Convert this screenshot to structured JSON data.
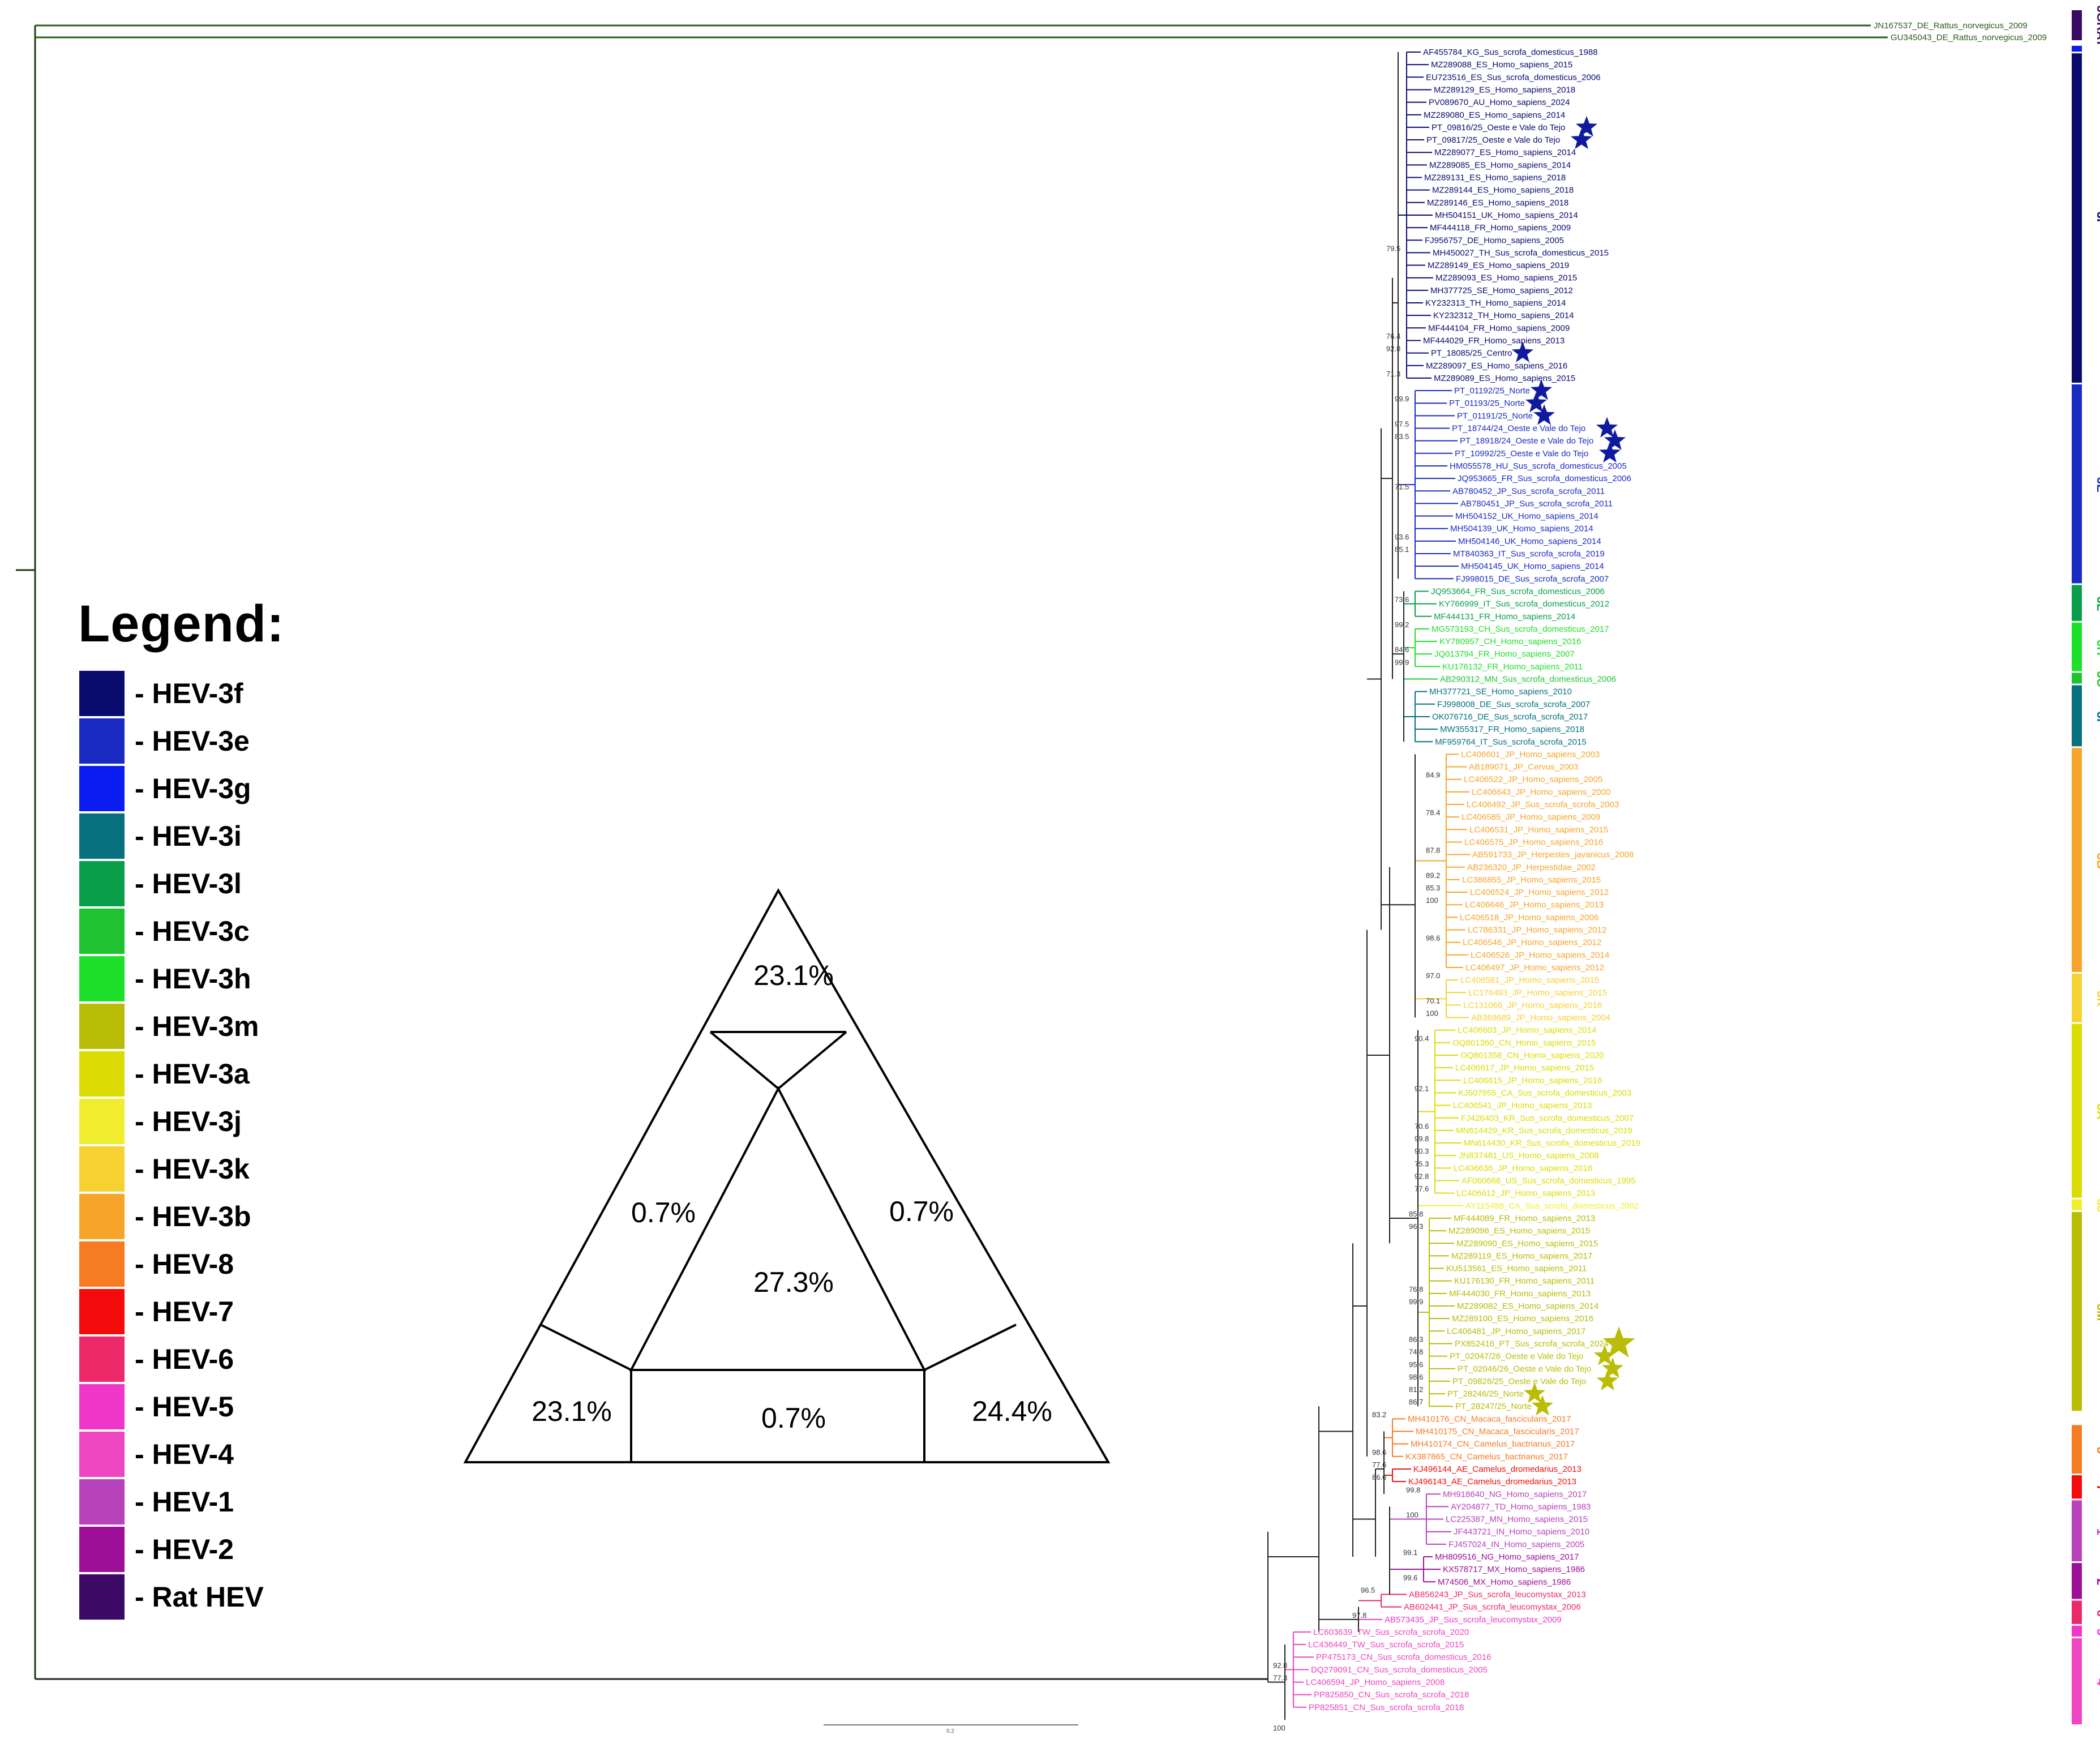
{
  "colors": {
    "3f": "#0b0b6e",
    "3e": "#1a2bc2",
    "3g": "#0b1cf3",
    "3i": "#06707f",
    "3l": "#099f4a",
    "3c": "#1fc331",
    "3h": "#1de02a",
    "3m": "#b9bd07",
    "3a": "#dcdc05",
    "3j": "#f1ee2f",
    "3k": "#f6d132",
    "3b": "#f6a52a",
    "hev8": "#f77b23",
    "hev7": "#f40b0b",
    "hev6": "#ec2a6a",
    "hev5": "#f037c9",
    "hev4": "#ee45c0",
    "hev1": "#b742bb",
    "hev2": "#9d0f96",
    "rat": "#3a0a64",
    "outgroup": "#2a5c1c",
    "star": "#0f1a9e",
    "star_m": "#b9bd07"
  },
  "legend": {
    "title": "Legend:",
    "items": [
      {
        "label": "- HEV-3f",
        "color": "#0b0b6e"
      },
      {
        "label": "- HEV-3e",
        "color": "#1a2bc2"
      },
      {
        "label": "- HEV-3g",
        "color": "#0b1cf3"
      },
      {
        "label": "- HEV-3i",
        "color": "#06707f"
      },
      {
        "label": "- HEV-3l",
        "color": "#099f4a"
      },
      {
        "label": "- HEV-3c",
        "color": "#1fc331"
      },
      {
        "label": "- HEV-3h",
        "color": "#1de02a"
      },
      {
        "label": "- HEV-3m",
        "color": "#b9bd07"
      },
      {
        "label": "- HEV-3a",
        "color": "#dcdc05"
      },
      {
        "label": "- HEV-3j",
        "color": "#f1ee2f"
      },
      {
        "label": "- HEV-3k",
        "color": "#f6d132"
      },
      {
        "label": "- HEV-3b",
        "color": "#f6a52a"
      },
      {
        "label": "- HEV-8",
        "color": "#f77b23"
      },
      {
        "label": "- HEV-7",
        "color": "#f40b0b"
      },
      {
        "label": "- HEV-6",
        "color": "#ec2a6a"
      },
      {
        "label": "- HEV-5",
        "color": "#f037c9"
      },
      {
        "label": "- HEV-4",
        "color": "#ee45c0"
      },
      {
        "label": "- HEV-1",
        "color": "#b742bb"
      },
      {
        "label": "- HEV-2",
        "color": "#9d0f96"
      },
      {
        "label": "- Rat HEV",
        "color": "#3a0a64"
      }
    ]
  },
  "triangle": {
    "top": "23.1%",
    "left_mid": "0.7%",
    "right_mid": "0.7%",
    "center": "27.3%",
    "bottom_left": "23.1%",
    "bottom_mid": "0.7%",
    "bottom_right": "24.4%"
  },
  "outgroup": [
    {
      "label": "JN167537_DE_Rattus_norvegicus_2009"
    },
    {
      "label": "GU345043_DE_Rattus_norvegicus_2009"
    }
  ],
  "taxa": [
    {
      "label": "AF455784_KG_Sus_scrofa_domesticus_1988",
      "c": "3f"
    },
    {
      "label": "MZ289088_ES_Homo_sapiens_2015",
      "c": "3f"
    },
    {
      "label": "EU723516_ES_Sus_scrofa_domesticus_2006",
      "c": "3f"
    },
    {
      "label": "MZ289129_ES_Homo_sapiens_2018",
      "c": "3f"
    },
    {
      "label": "PV089670_AU_Homo_sapiens_2024",
      "c": "3f"
    },
    {
      "label": "MZ289080_ES_Homo_sapiens_2014",
      "c": "3f"
    },
    {
      "label": "PT_09816/25_Oeste e Vale do Tejo",
      "c": "3f",
      "star": true
    },
    {
      "label": "PT_09817/25_Oeste e Vale do Tejo",
      "c": "3f",
      "star": true
    },
    {
      "label": "MZ289077_ES_Homo_sapiens_2014",
      "c": "3f"
    },
    {
      "label": "MZ289085_ES_Homo_sapiens_2014",
      "c": "3f"
    },
    {
      "label": "MZ289131_ES_Homo_sapiens_2018",
      "c": "3f"
    },
    {
      "label": "MZ289144_ES_Homo_sapiens_2018",
      "c": "3f"
    },
    {
      "label": "MZ289146_ES_Homo_sapiens_2018",
      "c": "3f"
    },
    {
      "label": "MH504151_UK_Homo_sapiens_2014",
      "c": "3f"
    },
    {
      "label": "MF444118_FR_Homo_sapiens_2009",
      "c": "3f"
    },
    {
      "label": "FJ956757_DE_Homo_sapiens_2005",
      "c": "3f"
    },
    {
      "label": "MH450027_TH_Sus_scrofa_domesticus_2015",
      "c": "3f"
    },
    {
      "label": "MZ289149_ES_Homo_sapiens_2019",
      "c": "3f"
    },
    {
      "label": "MZ289093_ES_Homo_sapiens_2015",
      "c": "3f"
    },
    {
      "label": "MH377725_SE_Homo_sapiens_2012",
      "c": "3f"
    },
    {
      "label": "KY232313_TH_Homo_sapiens_2014",
      "c": "3f"
    },
    {
      "label": "KY232312_TH_Homo_sapiens_2014",
      "c": "3f"
    },
    {
      "label": "MF444104_FR_Homo_sapiens_2009",
      "c": "3f"
    },
    {
      "label": "MF444029_FR_Homo_sapiens_2013",
      "c": "3f"
    },
    {
      "label": "PT_18085/25_Centro",
      "c": "3f",
      "star": true
    },
    {
      "label": "MZ289097_ES_Homo_sapiens_2016",
      "c": "3f"
    },
    {
      "label": "MZ289089_ES_Homo_sapiens_2015",
      "c": "3f"
    },
    {
      "label": "PT_01192/25_Norte",
      "c": "3e",
      "star": true
    },
    {
      "label": "PT_01193/25_Norte",
      "c": "3e",
      "star": true
    },
    {
      "label": "PT_01191/25_Norte",
      "c": "3e",
      "star": true
    },
    {
      "label": "PT_18744/24_Oeste e Vale do Tejo",
      "c": "3e",
      "star": true
    },
    {
      "label": "PT_18918/24_Oeste e Vale do Tejo",
      "c": "3e",
      "star": true
    },
    {
      "label": "PT_10992/25_Oeste e Vale do Tejo",
      "c": "3e",
      "star": true
    },
    {
      "label": "HM055578_HU_Sus_scrofa_domesticus_2005",
      "c": "3e"
    },
    {
      "label": "JQ953665_FR_Sus_scrofa_domesticus_2006",
      "c": "3e"
    },
    {
      "label": "AB780452_JP_Sus_scrofa_scrofa_2011",
      "c": "3e"
    },
    {
      "label": "AB780451_JP_Sus_scrofa_scrofa_2011",
      "c": "3e"
    },
    {
      "label": "MH504152_UK_Homo_sapiens_2014",
      "c": "3e"
    },
    {
      "label": "MH504139_UK_Homo_sapiens_2014",
      "c": "3e"
    },
    {
      "label": "MH504146_UK_Homo_sapiens_2014",
      "c": "3e"
    },
    {
      "label": "MT840363_IT_Sus_scrofa_scrofa_2019",
      "c": "3e"
    },
    {
      "label": "MH504145_UK_Homo_sapiens_2014",
      "c": "3e"
    },
    {
      "label": "FJ998015_DE_Sus_scrofa_scrofa_2007",
      "c": "3e"
    },
    {
      "label": "JQ953664_FR_Sus_scrofa_domesticus_2006",
      "c": "3l"
    },
    {
      "label": "KY766999_IT_Sus_scrofa_domesticus_2012",
      "c": "3l"
    },
    {
      "label": "MF444131_FR_Homo_sapiens_2014",
      "c": "3l"
    },
    {
      "label": "MG573193_CH_Sus_scrofa_domesticus_2017",
      "c": "3h"
    },
    {
      "label": "KY780957_CH_Homo_sapiens_2016",
      "c": "3h"
    },
    {
      "label": "JQ013794_FR_Homo_sapiens_2007",
      "c": "3h"
    },
    {
      "label": "KU176132_FR_Homo_sapiens_2011",
      "c": "3h"
    },
    {
      "label": "AB290312_MN_Sus_scrofa_domesticus_2006",
      "c": "3c"
    },
    {
      "label": "MH377721_SE_Homo_sapiens_2010",
      "c": "3i"
    },
    {
      "label": "FJ998008_DE_Sus_scrofa_scrofa_2007",
      "c": "3i"
    },
    {
      "label": "OK076716_DE_Sus_scrofa_scrofa_2017",
      "c": "3i"
    },
    {
      "label": "MW355317_FR_Homo_sapiens_2018",
      "c": "3i"
    },
    {
      "label": "MF959764_IT_Sus_scrofa_scrofa_2015",
      "c": "3i"
    },
    {
      "label": "LC406601_JP_Homo_sapiens_2003",
      "c": "3b"
    },
    {
      "label": "AB189071_JP_Cervus_2003",
      "c": "3b"
    },
    {
      "label": "LC406522_JP_Homo_sapiens_2005",
      "c": "3b"
    },
    {
      "label": "LC406643_JP_Homo_sapiens_2000",
      "c": "3b"
    },
    {
      "label": "LC406492_JP_Sus_scrofa_scrofa_2003",
      "c": "3b"
    },
    {
      "label": "LC406585_JP_Homo_sapiens_2009",
      "c": "3b"
    },
    {
      "label": "LC406531_JP_Homo_sapiens_2015",
      "c": "3b"
    },
    {
      "label": "LC406575_JP_Homo_sapiens_2016",
      "c": "3b"
    },
    {
      "label": "AB591733_JP_Herpestes_javanicus_2008",
      "c": "3b"
    },
    {
      "label": "AB236320_JP_Herpestidae_2002",
      "c": "3b"
    },
    {
      "label": "LC386855_JP_Homo_sapiens_2015",
      "c": "3b"
    },
    {
      "label": "LC406524_JP_Homo_sapiens_2012",
      "c": "3b"
    },
    {
      "label": "LC406646_JP_Homo_sapiens_2013",
      "c": "3b"
    },
    {
      "label": "LC406518_JP_Homo_sapiens_2006",
      "c": "3b"
    },
    {
      "label": "LC786331_JP_Homo_sapiens_2012",
      "c": "3b"
    },
    {
      "label": "LC406546_JP_Homo_sapiens_2012",
      "c": "3b"
    },
    {
      "label": "LC406526_JP_Homo_sapiens_2014",
      "c": "3b"
    },
    {
      "label": "LC406497_JP_Homo_sapiens_2012",
      "c": "3b"
    },
    {
      "label": "LC406581_JP_Homo_sapiens_2015",
      "c": "3k"
    },
    {
      "label": "LC176493_JP_Homo_sapiens_2015",
      "c": "3k"
    },
    {
      "label": "LC131066_JP_Homo_sapiens_2016",
      "c": "3k"
    },
    {
      "label": "AB369689_JP_Homo_sapiens_2004",
      "c": "3k"
    },
    {
      "label": "LC406603_JP_Homo_sapiens_2014",
      "c": "3a"
    },
    {
      "label": "OQ801360_CN_Homo_sapiens_2015",
      "c": "3a"
    },
    {
      "label": "OQ801358_CN_Homo_sapiens_2020",
      "c": "3a"
    },
    {
      "label": "LC406617_JP_Homo_sapiens_2015",
      "c": "3a"
    },
    {
      "label": "LC406615_JP_Homo_sapiens_2016",
      "c": "3a"
    },
    {
      "label": "KJ507955_CA_Sus_scrofa_domesticus_2003",
      "c": "3a"
    },
    {
      "label": "LC406541_JP_Homo_sapiens_2013",
      "c": "3a"
    },
    {
      "label": "FJ426403_KR_Sus_scrofa_domesticus_2007",
      "c": "3a"
    },
    {
      "label": "MN614429_KR_Sus_scrofa_domesticus_2019",
      "c": "3a"
    },
    {
      "label": "MN614430_KR_Sus_scrofa_domesticus_2019",
      "c": "3a"
    },
    {
      "label": "JN837481_US_Homo_sapiens_2008",
      "c": "3a"
    },
    {
      "label": "LC406636_JP_Homo_sapiens_2016",
      "c": "3a"
    },
    {
      "label": "AF060668_US_Sus_scrofa_domesticus_1995",
      "c": "3a"
    },
    {
      "label": "LC406612_JP_Homo_sapiens_2013",
      "c": "3a"
    },
    {
      "label": "AY115488_CA_Sus_scrofa_domesticus_2002",
      "c": "3j"
    },
    {
      "label": "MF444089_FR_Homo_sapiens_2013",
      "c": "3m"
    },
    {
      "label": "MZ289096_ES_Homo_sapiens_2015",
      "c": "3m"
    },
    {
      "label": "MZ289090_ES_Homo_sapiens_2015",
      "c": "3m"
    },
    {
      "label": "MZ289119_ES_Homo_sapiens_2017",
      "c": "3m"
    },
    {
      "label": "KU513561_ES_Homo_sapiens_2011",
      "c": "3m"
    },
    {
      "label": "KU176130_FR_Homo_sapiens_2011",
      "c": "3m"
    },
    {
      "label": "MF444030_FR_Homo_sapiens_2013",
      "c": "3m"
    },
    {
      "label": "MZ289082_ES_Homo_sapiens_2014",
      "c": "3m"
    },
    {
      "label": "MZ289100_ES_Homo_sapiens_2016",
      "c": "3m"
    },
    {
      "label": "LC406481_JP_Homo_sapiens_2017",
      "c": "3m"
    },
    {
      "label": "PX852416_PT_Sus_scrofa_scrofa_2024",
      "c": "3m",
      "star": true,
      "big": true
    },
    {
      "label": "PT_02047/26_Oeste e Vale do Tejo",
      "c": "3m",
      "star": true
    },
    {
      "label": "PT_02046/26_Oeste e Vale do Tejo",
      "c": "3m",
      "star": true
    },
    {
      "label": "PT_09826/25_Oeste e Vale do Tejo",
      "c": "3m",
      "star": true
    },
    {
      "label": "PT_28246/25_Norte",
      "c": "3m",
      "star": true
    },
    {
      "label": "PT_28247/25_Norte",
      "c": "3m",
      "star": true
    },
    {
      "label": "MH410176_CN_Macaca_fascicularis_2017",
      "c": "hev8"
    },
    {
      "label": "MH410175_CN_Macaca_fascicularis_2017",
      "c": "hev8"
    },
    {
      "label": "MH410174_CN_Camelus_bactrianus_2017",
      "c": "hev8"
    },
    {
      "label": "KX387865_CN_Camelus_bactrianus_2017",
      "c": "hev8"
    },
    {
      "label": "KJ496144_AE_Camelus_dromedarius_2013",
      "c": "hev7"
    },
    {
      "label": "KJ496143_AE_Camelus_dromedarius_2013",
      "c": "hev7"
    },
    {
      "label": "MH918640_NG_Homo_sapiens_2017",
      "c": "hev1"
    },
    {
      "label": "AY204877_TD_Homo_sapiens_1983",
      "c": "hev1"
    },
    {
      "label": "LC225387_MN_Homo_sapiens_2015",
      "c": "hev1"
    },
    {
      "label": "JF443721_IN_Homo_sapiens_2010",
      "c": "hev1"
    },
    {
      "label": "FJ457024_IN_Homo_sapiens_2005",
      "c": "hev1"
    },
    {
      "label": "MH809516_NG_Homo_sapiens_2017",
      "c": "hev2"
    },
    {
      "label": "KX578717_MX_Homo_sapiens_1986",
      "c": "hev2"
    },
    {
      "label": "M74506_MX_Homo_sapiens_1986",
      "c": "hev2"
    },
    {
      "label": "AB856243_JP_Sus_scrofa_leucomystax_2013",
      "c": "hev6"
    },
    {
      "label": "AB602441_JP_Sus_scrofa_leucomystax_2006",
      "c": "hev6"
    },
    {
      "label": "AB573435_JP_Sus_scrofa_leucomystax_2009",
      "c": "hev5"
    },
    {
      "label": "LC603639_TW_Sus_scrofa_scrofa_2020",
      "c": "hev4"
    },
    {
      "label": "LC436449_TW_Sus_scrofa_scrofa_2015",
      "c": "hev4"
    },
    {
      "label": "PP475173_CN_Sus_scrofa_domesticus_2016",
      "c": "hev4"
    },
    {
      "label": "DQ279091_CN_Sus_scrofa_domesticus_2005",
      "c": "hev4"
    },
    {
      "label": "LC406594_JP_Homo_sapiens_2008",
      "c": "hev4"
    },
    {
      "label": "PP825850_CN_Sus_scrofa_scrofa_2018",
      "c": "hev4"
    },
    {
      "label": "PP825851_CN_Sus_scrofa_scrofa_2018",
      "c": "hev4"
    }
  ],
  "bootstrap": [
    {
      "v": "79.5",
      "row": 16
    },
    {
      "v": "85.3",
      "row": 67
    },
    {
      "v": "96.3",
      "row": 94
    },
    {
      "v": "99.6",
      "row": 122
    },
    {
      "v": "77.3",
      "row": 130
    },
    {
      "v": "100",
      "row": 134
    },
    {
      "v": "76.9",
      "row": 138
    },
    {
      "v": "98.6",
      "row": 112
    },
    {
      "v": "86.6",
      "row": 114
    },
    {
      "v": "77.6",
      "row": 113
    },
    {
      "v": "99.8",
      "row": 115
    },
    {
      "v": "100",
      "row": 117
    },
    {
      "v": "99.1",
      "row": 120
    },
    {
      "v": "97.8",
      "row": 125
    },
    {
      "v": "92.8",
      "row": 129
    },
    {
      "v": "96.5",
      "row": 123
    },
    {
      "v": "99.9",
      "row": 49
    },
    {
      "v": "84.9",
      "row": 58
    },
    {
      "v": "78.4",
      "row": 61
    },
    {
      "v": "97.0",
      "row": 74
    },
    {
      "v": "70.1",
      "row": 76
    },
    {
      "v": "100",
      "row": 77
    },
    {
      "v": "90.4",
      "row": 79
    },
    {
      "v": "92.1",
      "row": 83
    },
    {
      "v": "70.6",
      "row": 86
    },
    {
      "v": "90.3",
      "row": 88
    },
    {
      "v": "75.3",
      "row": 89
    },
    {
      "v": "92.8",
      "row": 90
    },
    {
      "v": "77.6",
      "row": 91
    },
    {
      "v": "85.8",
      "row": 93
    },
    {
      "v": "86.3",
      "row": 103
    },
    {
      "v": "74.8",
      "row": 104
    },
    {
      "v": "95.6",
      "row": 105
    },
    {
      "v": "98.6",
      "row": 106
    },
    {
      "v": "81.2",
      "row": 107
    },
    {
      "v": "86.7",
      "row": 108
    },
    {
      "v": "83.2",
      "row": 109
    },
    {
      "v": "73.6",
      "row": 44
    },
    {
      "v": "99.2",
      "row": 46
    },
    {
      "v": "84.6",
      "row": 48
    },
    {
      "v": "71.3",
      "row": 26
    },
    {
      "v": "92.8",
      "row": 24
    },
    {
      "v": "76.4",
      "row": 23
    },
    {
      "v": "99.9",
      "row": 28
    },
    {
      "v": "97.5",
      "row": 30
    },
    {
      "v": "83.5",
      "row": 31
    },
    {
      "v": "71.5",
      "row": 35
    },
    {
      "v": "93.6",
      "row": 39
    },
    {
      "v": "85.1",
      "row": 40
    },
    {
      "v": "99.8",
      "row": 87
    },
    {
      "v": "87.8",
      "row": 64
    },
    {
      "v": "89.2",
      "row": 66
    },
    {
      "v": "98.6",
      "row": 71
    },
    {
      "v": "100",
      "row": 68
    },
    {
      "v": "76.8",
      "row": 99
    },
    {
      "v": "99.9",
      "row": 100
    }
  ],
  "clade_bar": [
    {
      "label": "3GRAT",
      "c": "rat",
      "from": -1,
      "to": 0
    },
    {
      "label": "",
      "c": "3g",
      "from": 0,
      "to": 0.6
    },
    {
      "label": "3F",
      "c": "3f",
      "from": 0.6,
      "to": 27
    },
    {
      "label": "3E",
      "c": "3e",
      "from": 27,
      "to": 43
    },
    {
      "label": "3L",
      "c": "3l",
      "from": 43,
      "to": 46
    },
    {
      "label": "3H",
      "c": "3h",
      "from": 46,
      "to": 50
    },
    {
      "label": "3C",
      "c": "3c",
      "from": 50,
      "to": 51
    },
    {
      "label": "3I",
      "c": "3i",
      "from": 51,
      "to": 56
    },
    {
      "label": "3B",
      "c": "3b",
      "from": 56,
      "to": 74
    },
    {
      "label": "3K",
      "c": "3k",
      "from": 74,
      "to": 78
    },
    {
      "label": "3A",
      "c": "3a",
      "from": 78,
      "to": 92
    },
    {
      "label": "3J",
      "c": "3j",
      "from": 92,
      "to": 93
    },
    {
      "label": "3M",
      "c": "3m",
      "from": 93,
      "to": 109
    },
    {
      "label": "8",
      "c": "hev8",
      "from": 110,
      "to": 114
    },
    {
      "label": "7",
      "c": "hev7",
      "from": 114,
      "to": 116
    },
    {
      "label": "1",
      "c": "hev1",
      "from": 116,
      "to": 121
    },
    {
      "label": "2",
      "c": "hev2",
      "from": 121,
      "to": 124
    },
    {
      "label": "6",
      "c": "hev6",
      "from": 124,
      "to": 126
    },
    {
      "label": "5",
      "c": "hev5",
      "from": 126,
      "to": 127
    },
    {
      "label": "4",
      "c": "hev4",
      "from": 127,
      "to": 134
    }
  ],
  "scale_label": "0.2"
}
